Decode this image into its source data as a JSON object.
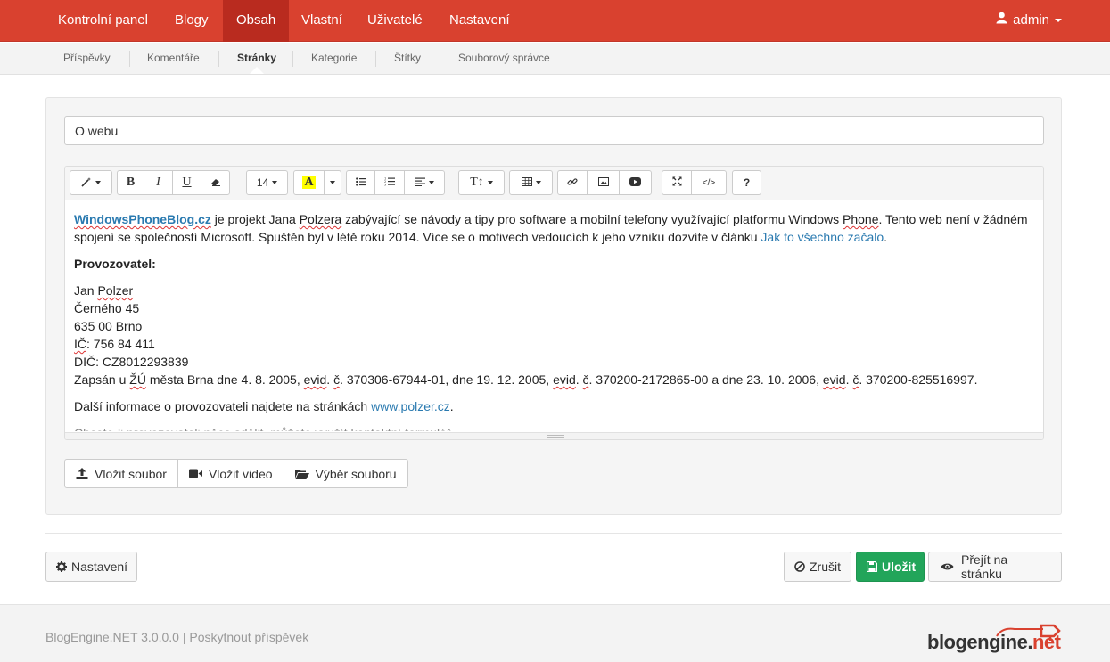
{
  "topnav": {
    "items": [
      "Kontrolní panel",
      "Blogy",
      "Obsah",
      "Vlastní",
      "Uživatelé",
      "Nastavení"
    ],
    "active": "Obsah",
    "user": "admin"
  },
  "subnav": {
    "items": [
      "Příspěvky",
      "Komentáře",
      "Stránky",
      "Kategorie",
      "Štítky",
      "Souborový správce"
    ],
    "active": "Stránky"
  },
  "page_title_value": "O webu",
  "toolbar": {
    "font_size": "14",
    "help_label": "?"
  },
  "content": {
    "p1": {
      "link_site": "WindowsPhoneBlog.cz",
      "text_a": " je projekt Jana ",
      "polzer_genitive": "Polzera",
      "text_b": " zabývající se návody a tipy pro software a mobilní telefony využívající platformu Windows ",
      "phone": "Phone",
      "text_c": ". Tento web není v žádném spojení se společností Microsoft. Spuštěn byl v létě roku 2014. Více se o motivech vedoucích k jeho vzniku dozvíte v článku ",
      "link_article": "Jak to všechno začalo",
      "text_d": "."
    },
    "operator_heading": "Provozovatel:",
    "address": {
      "name_first": "Jan ",
      "name_last": "Polzer",
      "street": "Černého 45",
      "city": "635 00 Brno",
      "ico_label": "IČ",
      "ico_value": ": 756 84 411",
      "dic": "DIČ: CZ8012293839",
      "reg_a": "Zapsán u ",
      "zu": "ŽÚ",
      "reg_b": " města Brna dne 4. 8. 2005, ",
      "evid": "evid",
      "reg_c": ". ",
      "c": "č",
      "reg_d": ". 370306-67944-01, dne 19. 12. 2005, ",
      "reg_e": ". 370200-2172865-00 a dne 23. 10. 2006, ",
      "reg_f": ". 370200-825516997."
    },
    "more_info_text": "Další informace o provozovateli najdete na stránkách ",
    "more_info_link": "www.polzer.cz",
    "more_info_end": ".",
    "clipped_line": "Chcete-li provozovateli něco sdělit, můžete využít kontaktní formulář."
  },
  "file_buttons": [
    "Vložit soubor",
    "Vložit video",
    "Výběr souboru"
  ],
  "actions": {
    "settings": "Nastavení",
    "cancel": "Zrušit",
    "save": "Uložit",
    "view": "Přejít na stránku"
  },
  "footer": {
    "text": "BlogEngine.NET 3.0.0.0 | Poskytnout příspěvek",
    "logo_main": "blogengine.",
    "logo_net": "net"
  },
  "colors": {
    "brand_red": "#d9412f",
    "active_red": "#b92b1f",
    "save_green": "#22a55a",
    "link_blue": "#2a7ab0"
  }
}
